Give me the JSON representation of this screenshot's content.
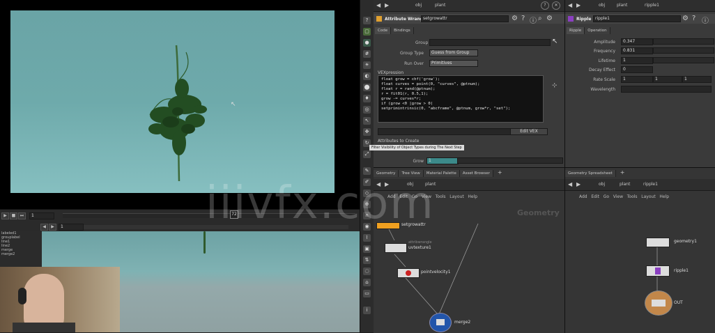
{
  "viewport": {
    "frame_label": "72",
    "start_frame": "1",
    "frame_field": "1"
  },
  "lower_list": [
    "labeled1",
    "grouplabel",
    "line1",
    "line2",
    "merge",
    "merge2"
  ],
  "path_bar": {
    "left": {
      "obj": "obj",
      "plant": "plant"
    },
    "right": {
      "obj": "obj",
      "plant": "plant",
      "node": "ripple1"
    }
  },
  "param_pane": {
    "node_type": "Attribute Wrangle",
    "node_name": "setgrowattr",
    "tabs": [
      "Code",
      "Bindings"
    ],
    "group_label": "Group",
    "group_type_label": "Group Type",
    "group_type_value": "Guess from Group",
    "run_over_label": "Run Over",
    "run_over_value": "Primitives",
    "vexpression_label": "VEXpression",
    "code_lines": [
      "float grow = chf('grow');",
      "float curves = point(0, \"curves\", @ptnum);",
      "float r = rand(@ptnum);",
      "r = fit01(r, 0.5,1);",
      "grow -= curves*r;",
      "if (grow <0 |grow > 0(",
      "setprimintrinsic(0, \"abcframe\", @ptnum, grow*r, \"set\");"
    ],
    "wrangle_button": "Edit VEX",
    "attributes_label": "Attributes to Create",
    "tooltip": "Filter Visibility of Object Types during The Next Step",
    "grow_label": "Grow",
    "grow_value": "1"
  },
  "param_pane2": {
    "node_type": "Ripple",
    "node_name": "ripple1",
    "tabs": [
      "Ripple",
      "Operation"
    ],
    "rows": [
      {
        "label": "Amplitude",
        "value": "0.347"
      },
      {
        "label": "Frequency",
        "value": "0.831"
      },
      {
        "label": "Lifetime",
        "value": "1"
      },
      {
        "label": "Decay Effect",
        "value": "0"
      },
      {
        "label": "Rate Scale",
        "value": "1"
      },
      {
        "label": "Wavelength",
        "value": ""
      }
    ],
    "rate_scale_extra": [
      "1",
      "1"
    ]
  },
  "net_pane": {
    "tabs": [
      "Geometry",
      "Tree View",
      "Material Palette",
      "Asset Browser"
    ],
    "menu": [
      "Add",
      "Edit",
      "Go",
      "View",
      "Tools",
      "Layout",
      "Help"
    ],
    "title": "Geometry",
    "nodes": [
      {
        "name": "setgrowattr",
        "sub": ""
      },
      {
        "name": "uvtexture1",
        "sub": "attribwrangle"
      },
      {
        "name": "pointvelocity1",
        "sub": ""
      },
      {
        "name": "merge2",
        "sub": ""
      }
    ]
  },
  "net_pane2": {
    "tabs": [
      "Geometry Spreadsheet"
    ],
    "menu": [
      "Add",
      "Edit",
      "Go",
      "View",
      "Tools",
      "Layout",
      "Help"
    ],
    "nodes": [
      {
        "name": "geometry1"
      },
      {
        "name": "ripple1"
      },
      {
        "name": "OUT"
      }
    ]
  },
  "watermark": "iiivfx.com",
  "colors": {
    "viewport_bg": "#6aa4a6",
    "node_orange": "#f0a020",
    "node_red": "#cc2222",
    "node_blue": "#2255aa",
    "node_purple": "#8a3fc0",
    "node_tan": "#c2874a"
  }
}
